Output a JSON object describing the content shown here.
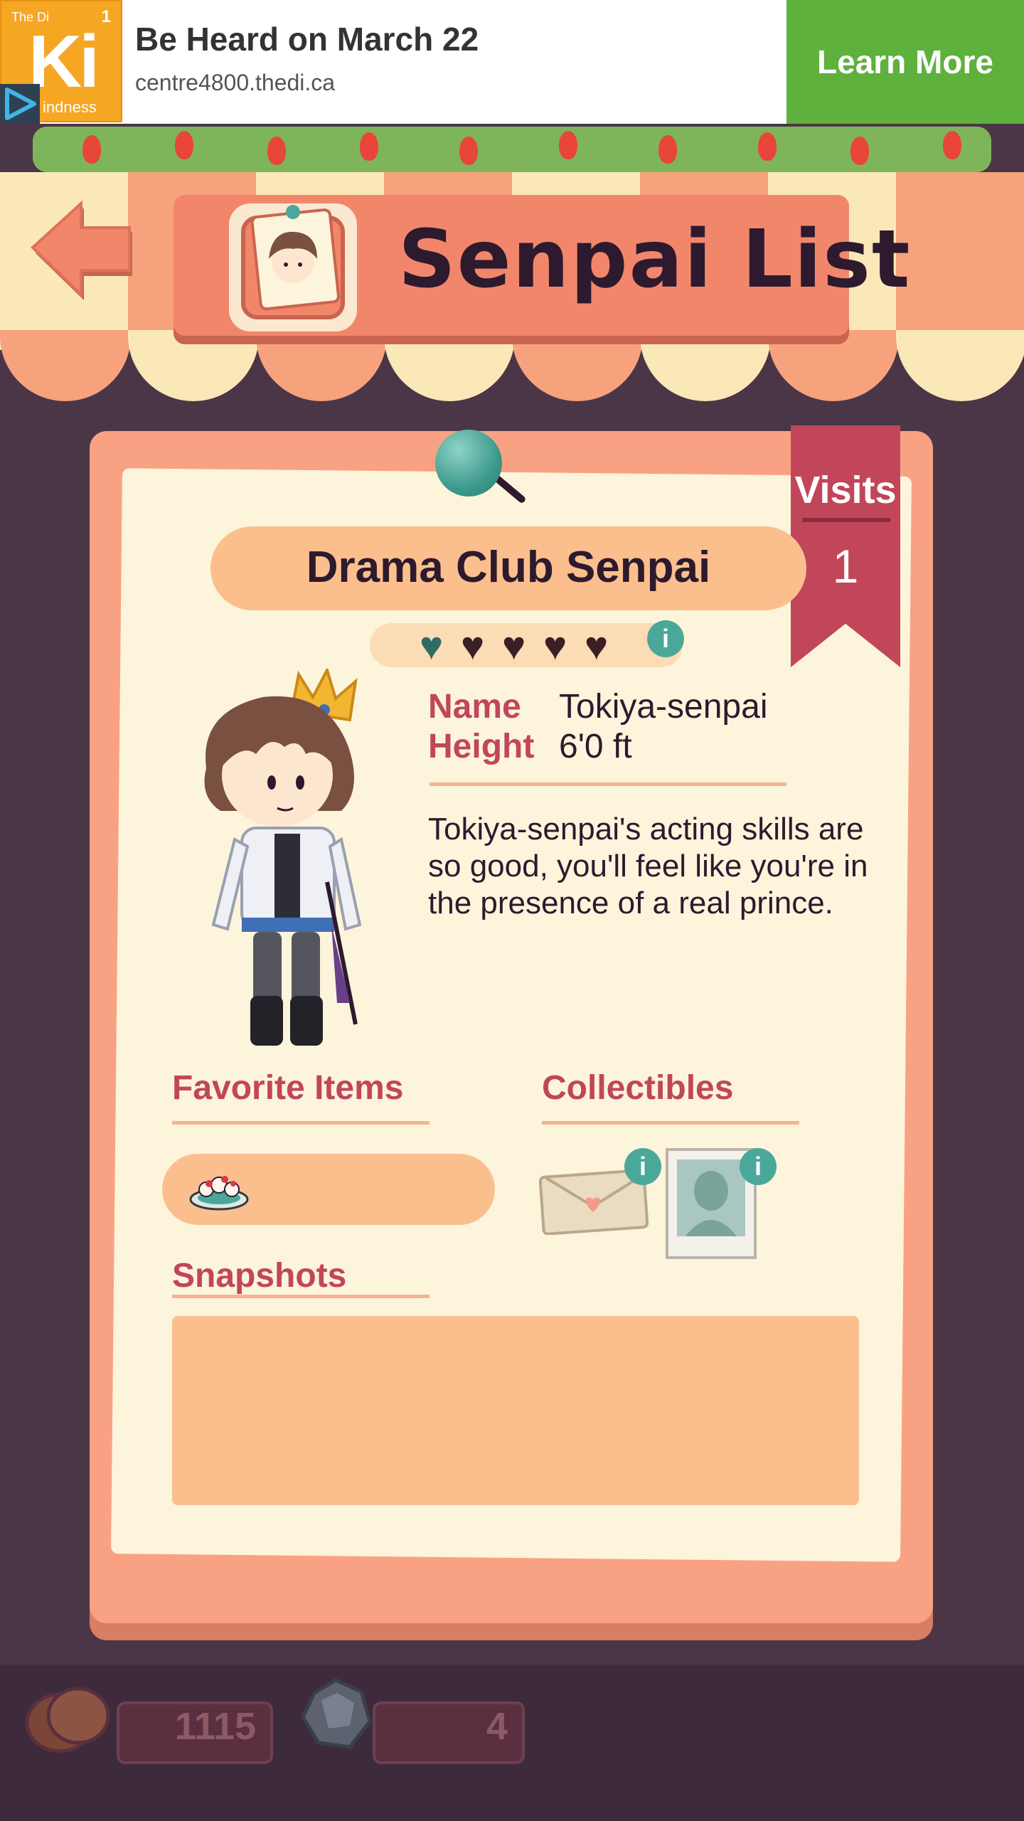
{
  "ad": {
    "logo_small": "The Di",
    "logo_number": "1",
    "logo_big": "Ki",
    "logo_sub": "indness",
    "title": "Be Heard on March 22",
    "url": "centre4800.thedi.ca",
    "cta": "Learn More"
  },
  "header": {
    "title": "Senpai List"
  },
  "card": {
    "visits_label": "Visits",
    "visits_value": "1",
    "senpai_title": "Drama Club Senpai",
    "hearts": {
      "filled": 1,
      "total": 5
    },
    "name_label": "Name",
    "name_value": "Tokiya-senpai",
    "height_label": "Height",
    "height_value": "6'0 ft",
    "description": "Tokiya-senpai's acting skills are so good, you'll feel like you're in the presence of a real prince.",
    "favorite_items_title": "Favorite Items",
    "collectibles_title": "Collectibles",
    "snapshots_title": "Snapshots",
    "info_glyph": "i"
  },
  "hud": {
    "coins": "1115",
    "gems": "4"
  },
  "colors": {
    "accent_red": "#c1465a",
    "teal": "#4aa89a",
    "peach": "#f9a283",
    "cream": "#fdf4dc",
    "ad_green": "#5eb13c",
    "ad_orange": "#f5a623"
  },
  "icons": [
    "back-arrow-icon",
    "senpai-portrait-icon",
    "heart-icon",
    "info-icon",
    "dessert-plate-icon",
    "love-letter-icon",
    "photo-silhouette-icon",
    "coins-icon",
    "gem-icon",
    "play-icon"
  ]
}
